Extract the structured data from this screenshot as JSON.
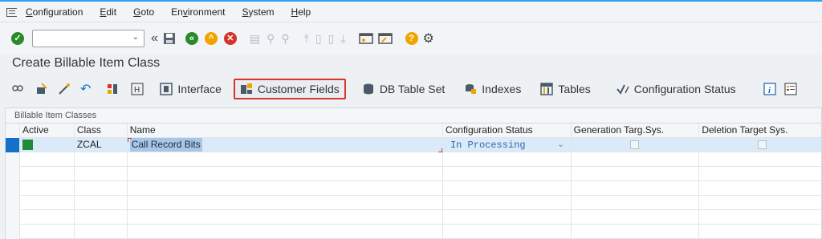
{
  "menu": {
    "items": [
      {
        "prefix": "",
        "underline": "C",
        "rest": "onfiguration"
      },
      {
        "prefix": "",
        "underline": "E",
        "rest": "dit"
      },
      {
        "prefix": "",
        "underline": "G",
        "rest": "oto"
      },
      {
        "prefix": "En",
        "underline": "v",
        "rest": "ironment"
      },
      {
        "prefix": "",
        "underline": "S",
        "rest": "ystem"
      },
      {
        "prefix": "",
        "underline": "H",
        "rest": "elp"
      }
    ]
  },
  "system_toolbar": {
    "command_field_value": "",
    "icons": [
      "enter-icon",
      "command-dropdown",
      "back-double-arrow-icon",
      "save-icon",
      "back-icon",
      "exit-icon",
      "cancel-icon",
      "print-icon",
      "find-icon",
      "find-next-icon",
      "first-page-icon",
      "previous-page-icon",
      "next-page-icon",
      "last-page-icon",
      "new-session-icon",
      "shortcut-icon",
      "help-icon",
      "settings-icon"
    ]
  },
  "page": {
    "title": "Create Billable Item Class"
  },
  "app_toolbar": {
    "buttons": [
      {
        "name": "interface",
        "label": "Interface"
      },
      {
        "name": "customer-fields",
        "label": "Customer Fields",
        "highlighted": true
      },
      {
        "name": "db-table-set",
        "label": "DB Table Set"
      },
      {
        "name": "indexes",
        "label": "Indexes"
      },
      {
        "name": "tables",
        "label": "Tables"
      },
      {
        "name": "configuration-status",
        "label": "Configuration Status"
      }
    ]
  },
  "table": {
    "caption": "Billable Item Classes",
    "columns": [
      "Active",
      "Class",
      "Name",
      "Configuration Status",
      "Generation Targ.Sys.",
      "Deletion Target Sys."
    ],
    "rows": [
      {
        "active": true,
        "class": "ZCAL",
        "name": "Call Record Bits",
        "status": "In Processing",
        "generation": false,
        "deletion": false
      }
    ],
    "empty_rows": 6
  },
  "colors": {
    "accent_blue": "#2b9ff0",
    "highlight_border": "#d9342b",
    "active_green": "#1f8a3a",
    "row_selected": "#dbeaf8"
  }
}
